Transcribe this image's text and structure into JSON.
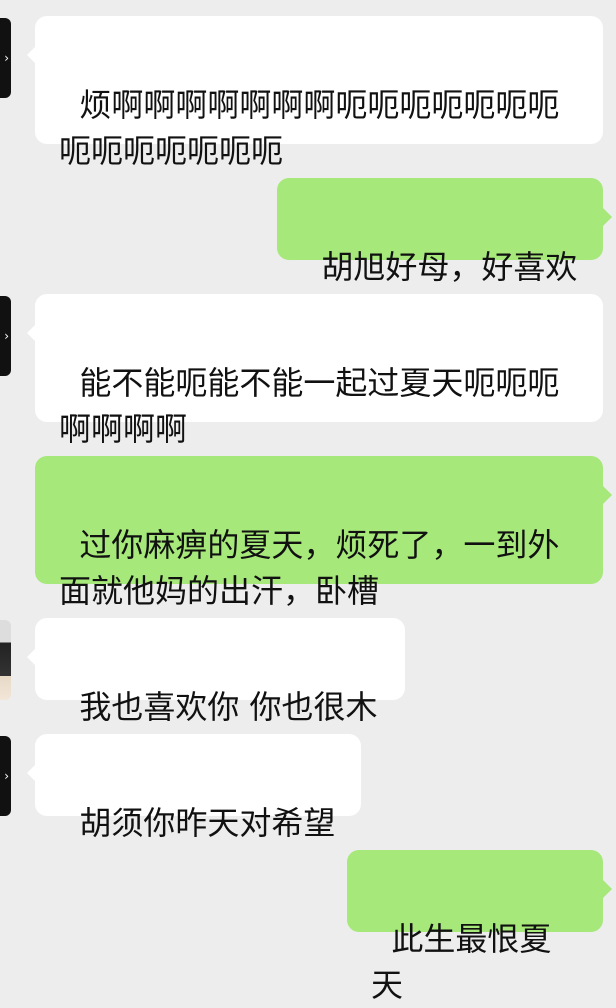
{
  "messages": [
    {
      "direction": "in",
      "text": "烦啊啊啊啊啊啊啊呃呃呃呃呃呃呃呃呃呃呃呃呃呃"
    },
    {
      "direction": "out",
      "text": "胡旭好母，好喜欢"
    },
    {
      "direction": "in",
      "text": "能不能呃能不能一起过夏天呃呃呃啊啊啊啊"
    },
    {
      "direction": "out",
      "text": "过你麻痹的夏天，烦死了，一到外面就他妈的出汗，卧槽"
    },
    {
      "direction": "in",
      "text": "我也喜欢你 你也很木"
    },
    {
      "direction": "in",
      "text": "胡须你昨天对希望"
    },
    {
      "direction": "out",
      "text": "此生最恨夏天"
    }
  ],
  "colors": {
    "background": "#ededed",
    "incoming_bubble": "#ffffff",
    "outgoing_bubble": "#a6e87a"
  }
}
